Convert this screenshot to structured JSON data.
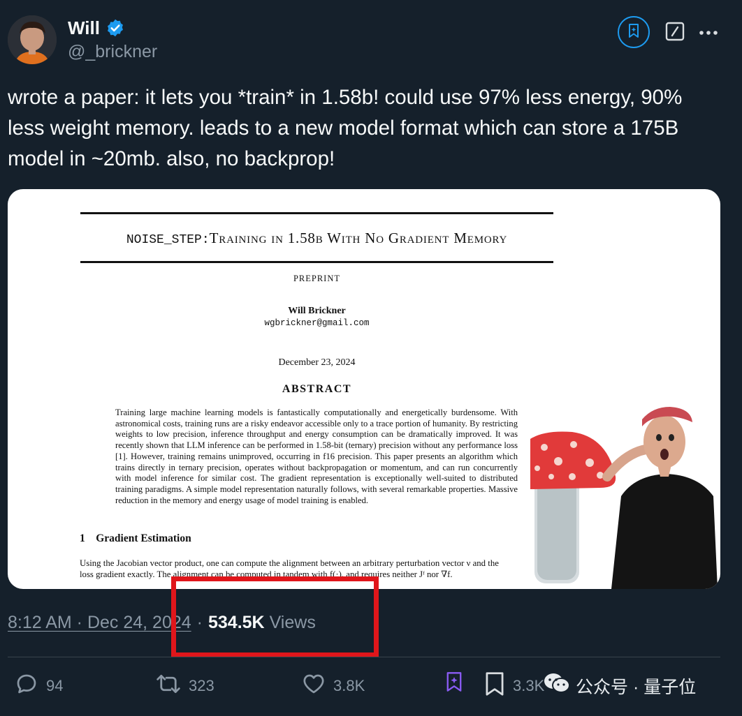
{
  "author": {
    "display_name": "Will",
    "handle": "@_brickner"
  },
  "tweet": {
    "text": "wrote a paper: it lets you *train* in 1.58b! could use 97% less energy, 90%\nless weight memory. leads to a new model format which can store a 175B\nmodel in ~20mb. also, no backprop!"
  },
  "paper": {
    "title": "NOISE_STEP: Training in 1.58b With No Gradient Memory",
    "title_mono": "NOISE_STEP:",
    "title_rest": " TRAINING IN 1.58B WITH NO GRADIENT MEMORY",
    "preprint": "PREPRINT",
    "author": "Will Brickner",
    "email": "wgbrickner@gmail.com",
    "date": "December 23, 2024",
    "abstract_heading": "ABSTRACT",
    "abstract": "Training large machine learning models is fantastically computationally and energetically burdensome. With astronomical costs, training runs are a risky endeavor accessible only to a trace portion of humanity. By restricting weights to low precision, inference throughput and energy consumption can be dramatically improved. It was recently shown that LLM inference can be performed in 1.58-bit (ternary) precision without any performance loss [1]. However, training remains unimproved, occurring in f16 precision. This paper presents an algorithm which trains directly in ternary precision, operates without backpropagation or momentum, and can run concurrently with model inference for similar cost. The gradient representation is exceptionally well-suited to distributed training paradigms. A simple model representation naturally follows, with several remarkable properties. Massive reduction in the memory and energy usage of model training is enabled.",
    "section_heading": "1    Gradient Estimation",
    "body_line_1": "Using the Jacobian vector product, one can compute the alignment between an arbitrary perturbation vector ν and the",
    "body_line_2": "loss gradient exactly. The alignment can be computed in tandem with f(·), and requires neither Jᶠ nor ∇f."
  },
  "meta": {
    "timestamp": "8:12 AM · Dec 24, 2024",
    "separator": "·",
    "views_count": "534.5K",
    "views_label": "Views"
  },
  "actions": {
    "replies": "94",
    "reposts": "323",
    "likes": "3.8K",
    "bookmarks": "3.3K"
  },
  "watermark": {
    "text": "公众号 · 量子位"
  },
  "colors": {
    "background": "#15202b",
    "accent": "#1d9bf0",
    "muted": "#8b98a5",
    "highlight": "#e0161b",
    "grok_purple": "#8b5cf6"
  },
  "icons": [
    "verified-badge-icon",
    "grok-icon",
    "edit-icon",
    "more-icon",
    "reply-icon",
    "repost-icon",
    "like-icon",
    "grok-action-icon",
    "bookmark-icon",
    "wechat-icon"
  ]
}
